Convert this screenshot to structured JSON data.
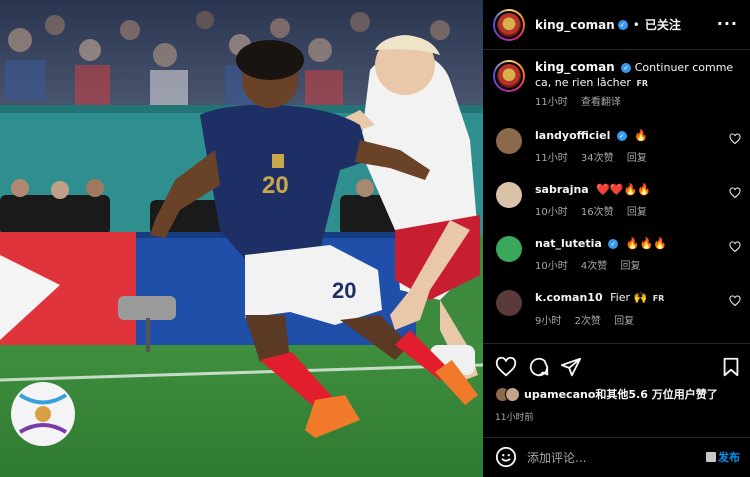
{
  "post": {
    "username": "king_coman",
    "verified_mark": "✓",
    "separator": "•",
    "follow_status": "已关注",
    "more_icon": "···",
    "photo_alt": "Football player in blue number 20 jersey dribbling past defender in white"
  },
  "caption": {
    "username": "king_coman",
    "text": "Continuer comme ca, ne rien lâcher",
    "lang_badge": "FR",
    "time": "11小时",
    "translate": "查看翻译"
  },
  "comments": [
    {
      "username": "landyofficiel",
      "verified": true,
      "text": "🔥",
      "time": "11小时",
      "likes": "34次赞",
      "reply": "回复",
      "avatar_color": "#8a6a4a"
    },
    {
      "username": "sabrajna",
      "verified": false,
      "text": "❤️❤️🔥🔥",
      "time": "10小时",
      "likes": "16次赞",
      "reply": "回复",
      "avatar_color": "#d9c2a8"
    },
    {
      "username": "nat_lutetia",
      "verified": true,
      "text": "🔥🔥🔥",
      "time": "10小时",
      "likes": "4次赞",
      "reply": "回复",
      "avatar_color": "#3aa85a"
    },
    {
      "username": "k.coman10",
      "verified": false,
      "text": "Fier 🙌",
      "lang_badge": "FR",
      "time": "9小时",
      "likes": "2次赞",
      "reply": "回复",
      "avatar_color": "#5a3a3a"
    }
  ],
  "engagement": {
    "likes_text": "upamecano和其他5.6 万位用户赞了",
    "time": "11小时前"
  },
  "add_comment": {
    "placeholder": "添加评论...",
    "post_label": "发布"
  },
  "colors": {
    "accent": "#0095f6",
    "verified": "#3897f0",
    "muted": "#a8a8a8"
  },
  "icons": [
    "heart-icon",
    "comment-icon",
    "share-icon",
    "bookmark-icon",
    "emoji-icon",
    "more-icon"
  ]
}
